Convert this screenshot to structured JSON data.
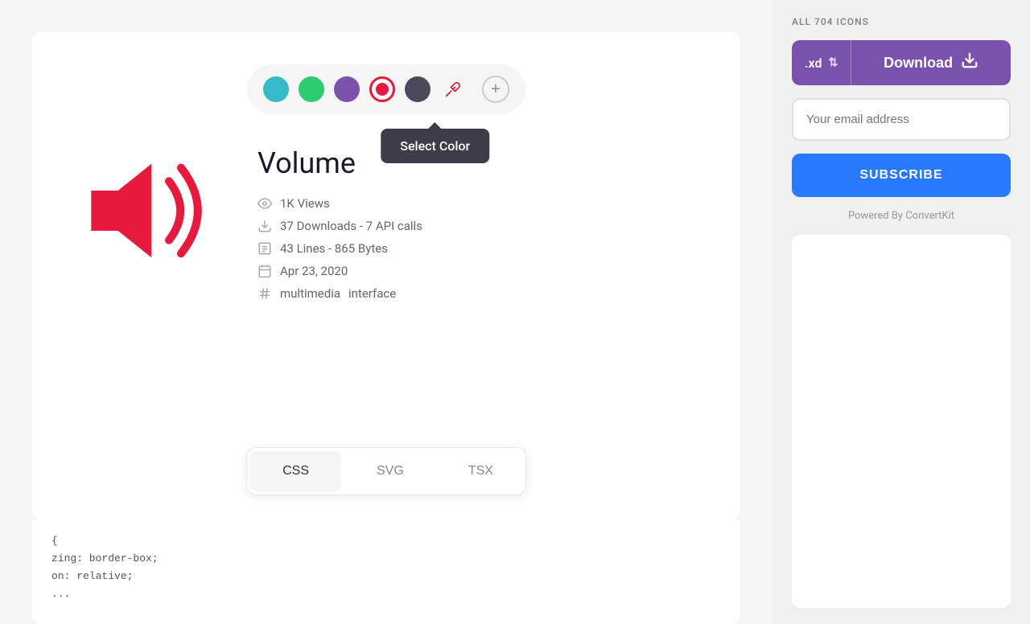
{
  "sidebar": {
    "all_icons_label": "ALL 704 ICONS",
    "format": ".xd",
    "download_label": "Download",
    "email_placeholder": "Your email address",
    "subscribe_label": "SUBSCRIBE",
    "powered_by": "Powered By ConvertKit"
  },
  "color_picker": {
    "colors": [
      {
        "id": "teal",
        "label": "Teal"
      },
      {
        "id": "green",
        "label": "Green"
      },
      {
        "id": "purple",
        "label": "Purple"
      },
      {
        "id": "red",
        "label": "Red",
        "selected": true
      },
      {
        "id": "dark",
        "label": "Dark"
      }
    ],
    "tooltip": "Select Color",
    "add_label": "+"
  },
  "icon": {
    "title": "Volume",
    "views": "1K Views",
    "downloads": "37 Downloads - 7 API calls",
    "lines": "43 Lines - 865 Bytes",
    "date": "Apr 23, 2020",
    "tags": [
      "multimedia",
      "interface"
    ]
  },
  "tabs": [
    {
      "id": "css",
      "label": "CSS",
      "active": true
    },
    {
      "id": "svg",
      "label": "SVG",
      "active": false
    },
    {
      "id": "tsx",
      "label": "TSX",
      "active": false
    }
  ],
  "code": {
    "lines": [
      "{",
      "zing: border-box;",
      "on: relative;",
      "  ..."
    ]
  }
}
